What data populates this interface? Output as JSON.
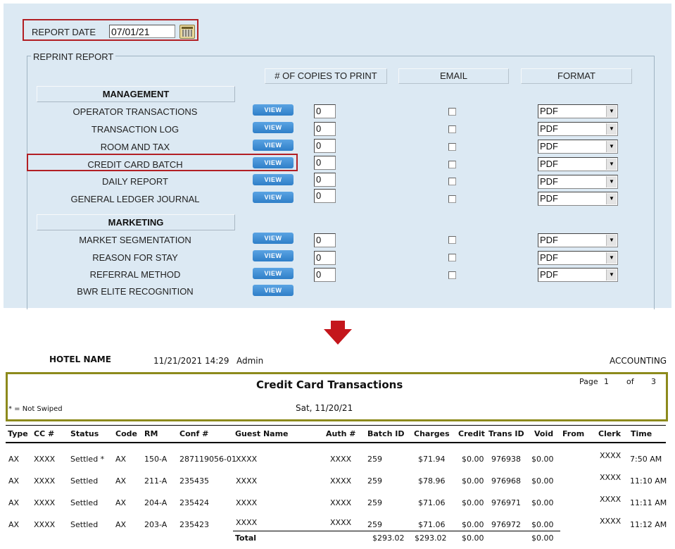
{
  "form": {
    "report_date_label": "REPORT DATE",
    "report_date_value": "07/01/21",
    "reprint_legend": "REPRINT REPORT",
    "col_headers": [
      "# OF COPIES TO PRINT",
      "EMAIL",
      "FORMAT"
    ],
    "view_label": "VIEW",
    "sections": [
      {
        "title": "MANAGEMENT",
        "rows": [
          {
            "label": "OPERATOR TRANSACTIONS",
            "copies": "0",
            "format": "PDF"
          },
          {
            "label": "TRANSACTION LOG",
            "copies": "0",
            "format": "PDF"
          },
          {
            "label": "ROOM AND TAX",
            "copies": "0",
            "format": "PDF"
          },
          {
            "label": "CREDIT CARD BATCH",
            "copies": "0",
            "format": "PDF"
          },
          {
            "label": "DAILY REPORT",
            "copies": "0",
            "format": "PDF"
          },
          {
            "label": "GENERAL LEDGER JOURNAL",
            "copies": "0",
            "format": "PDF"
          }
        ]
      },
      {
        "title": "MARKETING",
        "rows": [
          {
            "label": "MARKET SEGMENTATION",
            "copies": "0",
            "format": "PDF"
          },
          {
            "label": "REASON FOR STAY",
            "copies": "0",
            "format": "PDF"
          },
          {
            "label": "REFERRAL METHOD",
            "copies": "0",
            "format": "PDF"
          },
          {
            "label": "BWR ELITE RECOGNITION"
          }
        ]
      }
    ]
  },
  "report": {
    "hotel_name": "HOTEL NAME",
    "timestamp": "11/21/2021 14:29",
    "user": "Admin",
    "department": "ACCOUNTING",
    "title": "Credit Card Transactions",
    "page_word": "Page",
    "page_num": "1",
    "of_word": "of",
    "page_total": "3",
    "note": "* = Not Swiped",
    "date": "Sat, 11/20/21",
    "columns": [
      "Type",
      "CC #",
      "Status",
      "Code",
      "RM",
      "Conf #",
      "Guest Name",
      "Auth #",
      "Batch ID",
      "Charges",
      "Credit",
      "Trans ID",
      "Void",
      "From",
      "Clerk",
      "Time"
    ],
    "rows": [
      [
        "AX",
        "XXXX",
        "Settled *",
        "AX",
        "150-A",
        "287119056-01",
        "XXXX",
        "XXXX",
        "259",
        "$71.94",
        "$0.00",
        "976938",
        "$0.00",
        "",
        "XXXX",
        "7:50 AM"
      ],
      [
        "AX",
        "XXXX",
        "Settled",
        "AX",
        "211-A",
        "235435",
        "XXXX",
        "XXXX",
        "259",
        "$78.96",
        "$0.00",
        "976968",
        "$0.00",
        "",
        "XXXX",
        "11:10 AM"
      ],
      [
        "AX",
        "XXXX",
        "Settled",
        "AX",
        "204-A",
        "235424",
        "XXXX",
        "XXXX",
        "259",
        "$71.06",
        "$0.00",
        "976971",
        "$0.00",
        "",
        "XXXX",
        "11:11 AM"
      ],
      [
        "AX",
        "XXXX",
        "Settled",
        "AX",
        "203-A",
        "235423",
        "XXXX",
        "XXXX",
        "259",
        "$71.06",
        "$0.00",
        "976972",
        "$0.00",
        "",
        "XXXX",
        "11:12 AM"
      ]
    ],
    "total_label": "Total",
    "totals": {
      "batch": "$293.02",
      "charges": "$293.02",
      "credit": "$0.00",
      "void": "$0.00"
    }
  },
  "colors": {
    "highlight": "#b21f24",
    "arrow": "#c4161c",
    "report_box": "#8d8a1c",
    "view_button": "#3a8bd4"
  }
}
